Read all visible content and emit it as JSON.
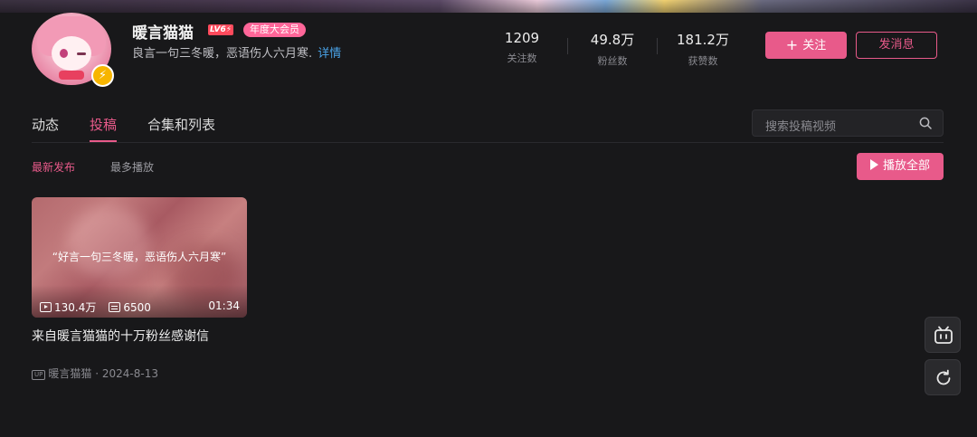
{
  "profile": {
    "name": "暖言猫猫",
    "level": "LV6⚡",
    "vip_tag": "年度大会员",
    "signature": "良言一句三冬暖，恶语伤人六月寒.",
    "signature_more": "详情"
  },
  "stats": [
    {
      "value": "1209",
      "label": "关注数"
    },
    {
      "value": "49.8万",
      "label": "粉丝数"
    },
    {
      "value": "181.2万",
      "label": "获赞数"
    }
  ],
  "actions": {
    "follow_icon": "+",
    "follow": "关注",
    "message": "发消息"
  },
  "tabs": [
    {
      "label": "动态"
    },
    {
      "label": "投稿"
    },
    {
      "label": "合集和列表"
    }
  ],
  "active_tab": "投稿",
  "search": {
    "placeholder": "搜索投稿视频"
  },
  "sort": {
    "latest": "最新发布",
    "most_played": "最多播放"
  },
  "play_all": "播放全部",
  "video": {
    "thumb_text": "“好言一句三冬暖，恶语伤人六月寒”",
    "views": "130.4万",
    "danmaku": "6500",
    "duration": "01:34",
    "title": "来自暖言猫猫的十万粉丝感谢信",
    "uploader": "暖言猫猫",
    "separator": "·",
    "date": "2024-8-13",
    "up_tag": "UP"
  },
  "colors": {
    "accent": "#e85a8a",
    "background": "#18181a",
    "link": "#4aa3e8"
  },
  "icons": {
    "tv": "bilibili-tv-icon",
    "refresh": "refresh-icon",
    "search": "search-icon"
  }
}
